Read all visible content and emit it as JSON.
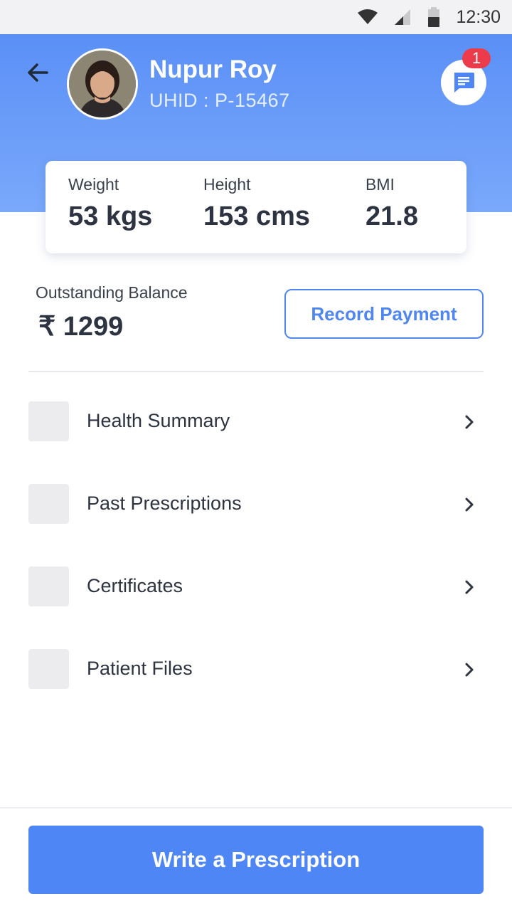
{
  "status_bar": {
    "time": "12:30",
    "icons": [
      "wifi-icon",
      "cellular-signal-icon",
      "battery-icon"
    ]
  },
  "header": {
    "patient_name": "Nupur Roy",
    "uhid": "UHID : P-15467",
    "notification_count": "1",
    "gradient_colors": [
      "#5a8ff6",
      "#7aa9fb"
    ]
  },
  "vitals": {
    "weight": {
      "label": "Weight",
      "value": "53 kgs"
    },
    "height": {
      "label": "Height",
      "value": "153 cms"
    },
    "bmi": {
      "label": "BMI",
      "value": "21.8"
    }
  },
  "balance": {
    "label": "Outstanding Balance",
    "value": "₹ 1299",
    "record_payment_label": "Record Payment"
  },
  "menu": {
    "items": [
      {
        "label": "Health Summary"
      },
      {
        "label": "Past Prescriptions"
      },
      {
        "label": "Certificates"
      },
      {
        "label": "Patient Files"
      }
    ]
  },
  "footer": {
    "primary_action_label": "Write a Prescription"
  },
  "colors": {
    "accent": "#4f86f6",
    "badge": "#ec3b4a",
    "text": "#2d3340"
  }
}
